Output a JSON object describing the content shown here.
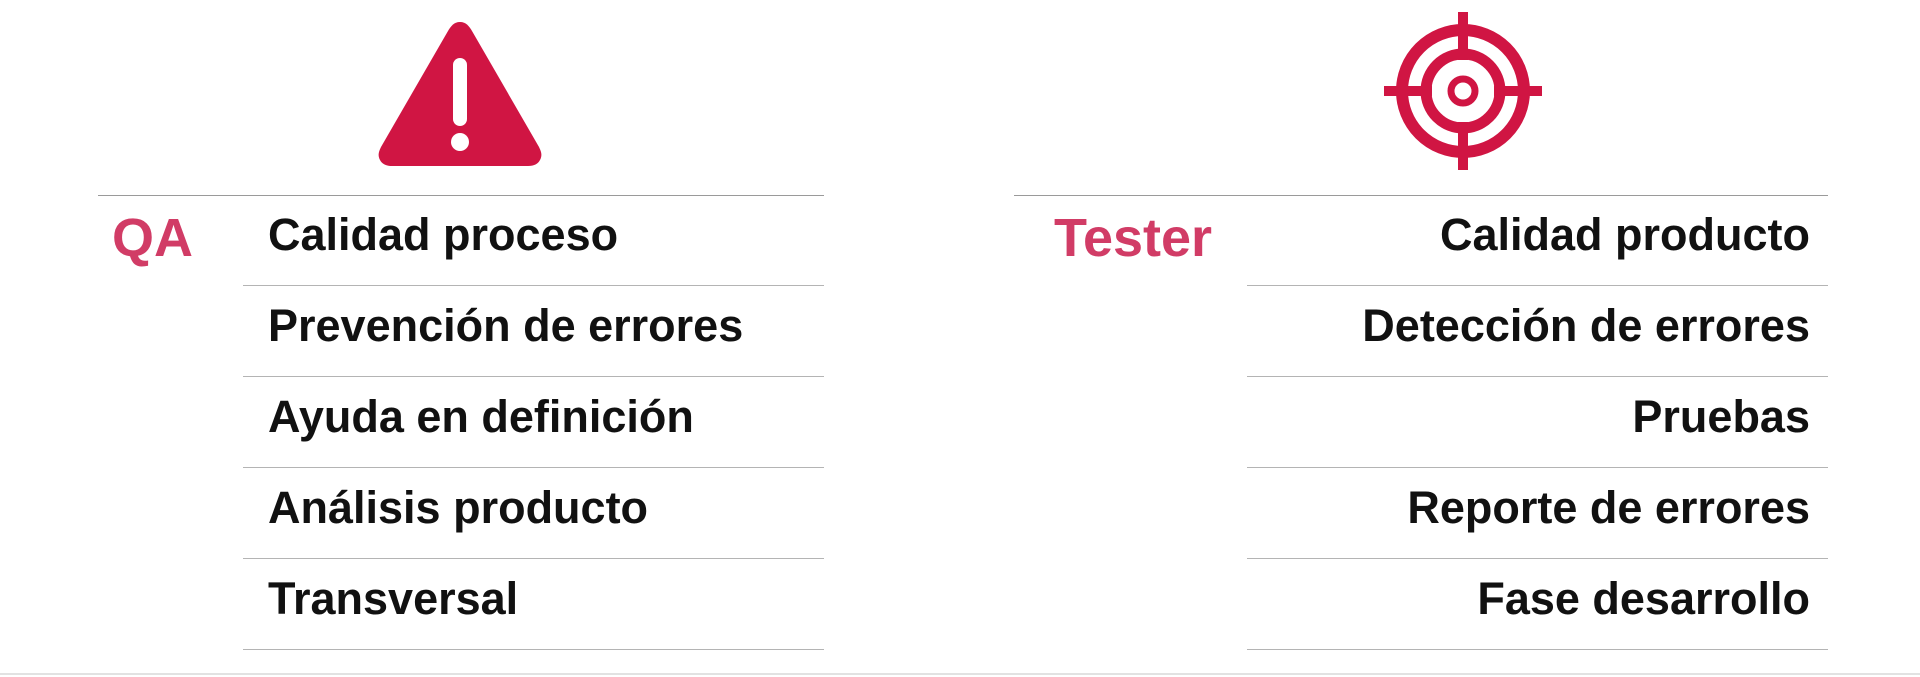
{
  "colors": {
    "accent": "#d01543",
    "label": "#d13c66",
    "text": "#111111",
    "divider": "#b4b4b4"
  },
  "qa": {
    "icon": "warning-icon",
    "label": "QA",
    "items": [
      "Calidad proceso",
      "Prevención de errores",
      "Ayuda en definición",
      "Análisis producto",
      "Transversal"
    ]
  },
  "tester": {
    "icon": "target-icon",
    "label": "Tester",
    "items": [
      "Calidad producto",
      "Detección de errores",
      "Pruebas",
      "Reporte de errores",
      "Fase desarrollo"
    ]
  }
}
